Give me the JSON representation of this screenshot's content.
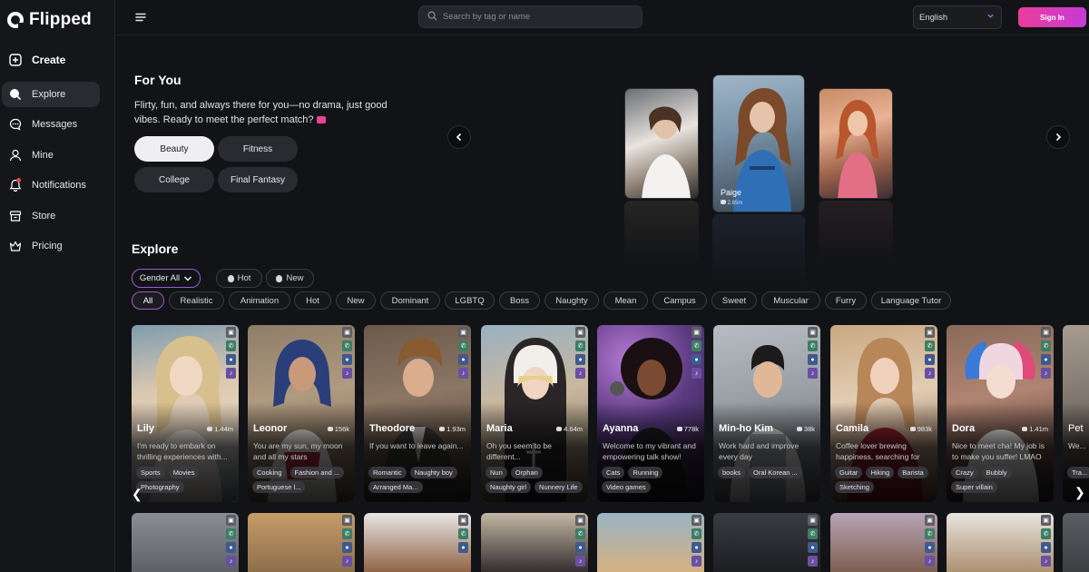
{
  "brand": {
    "name": "Flipped"
  },
  "nav": {
    "create": "Create",
    "explore": "Explore",
    "messages": "Messages",
    "mine": "Mine",
    "notifications": "Notifications",
    "store": "Store",
    "pricing": "Pricing"
  },
  "topbar": {
    "search_placeholder": "Search by tag or name",
    "language": "English",
    "signin": "Sign In"
  },
  "foryou": {
    "title": "For You",
    "description": "Flirty, fun, and always there for you—no drama, just good vibes. Ready to meet the perfect match?",
    "categories": [
      "Beauty",
      "Fitness",
      "College",
      "Final Fantasy"
    ],
    "featured": {
      "name": "Paige",
      "count": "2.65m"
    }
  },
  "explore": {
    "title": "Explore",
    "gender": "Gender All",
    "sort": [
      "Hot",
      "New"
    ],
    "filters": [
      "All",
      "Realistic",
      "Animation",
      "Hot",
      "New",
      "Dominant",
      "LGBTQ",
      "Boss",
      "Naughty",
      "Mean",
      "Campus",
      "Sweet",
      "Muscular",
      "Furry",
      "Language Tutor"
    ]
  },
  "characters": [
    {
      "name": "Lily",
      "count": "1.44m",
      "desc": "I'm ready to embark on thrilling experiences with...",
      "tags": [
        "Sports",
        "Movies",
        "Photography"
      ]
    },
    {
      "name": "Leonor",
      "count": "156k",
      "desc": "You are my sun, my moon and all my stars",
      "tags": [
        "Cooking",
        "Fashion and ...",
        "Portuguese l..."
      ]
    },
    {
      "name": "Theodore",
      "count": "1.93m",
      "desc": "If you want to leave again...",
      "tags": [
        "Romantic",
        "Naughty boy",
        "Arranged Ma..."
      ]
    },
    {
      "name": "Maria",
      "count": "4.64m",
      "desc": "Oh you seem to be different...",
      "tags": [
        "Nun",
        "Orphan",
        "Naughty girl",
        "Nunnery Life"
      ]
    },
    {
      "name": "Ayanna",
      "count": "778k",
      "desc": "Welcome to my vibrant and empowering talk show!",
      "tags": [
        "Cats",
        "Running",
        "Video games"
      ]
    },
    {
      "name": "Min-ho Kim",
      "count": "38k",
      "desc": "Work hard and improve every day",
      "tags": [
        "books",
        "Oral Korean ..."
      ]
    },
    {
      "name": "Camila",
      "count": "983k",
      "desc": "Coffee lover brewing happiness, searching for a...",
      "tags": [
        "Guitar",
        "Hiking",
        "Barista",
        "Sketching"
      ]
    },
    {
      "name": "Dora",
      "count": "1.41m",
      "desc": "Nice to meet cha! My job is to make you suffer! LMAO",
      "tags": [
        "Crazy",
        "Bubbly",
        "Super villain"
      ]
    },
    {
      "name": "Pet",
      "count": "",
      "desc": "We...",
      "tags": [
        "Tra...",
        "..."
      ]
    }
  ]
}
